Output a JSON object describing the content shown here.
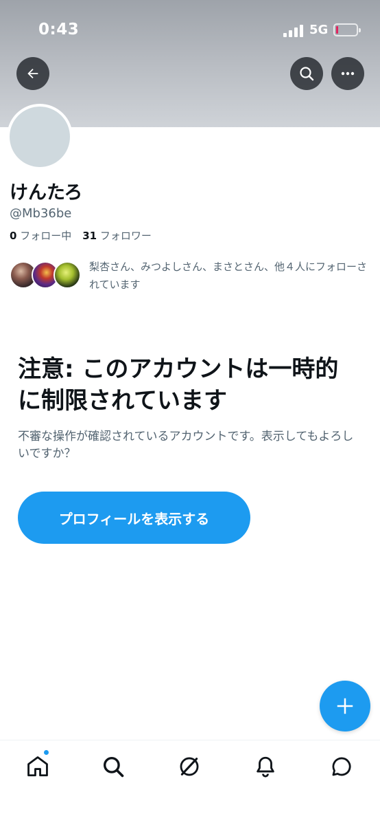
{
  "status_bar": {
    "time": "0:43",
    "network": "5G",
    "battery_level_fraction": 0.08,
    "battery_color": "#e0245e"
  },
  "header": {
    "back_icon": "arrow-left-icon",
    "search_icon": "search-icon",
    "more_icon": "more-horizontal-icon"
  },
  "profile": {
    "display_name": "けんたろ",
    "handle": "@Mb36be",
    "following_count": "0",
    "following_label": "フォロー中",
    "followers_count": "31",
    "followers_label": "フォロワー",
    "followed_by_text": "梨杏さん、みつよしさん、まさとさん、他４人にフォローされています"
  },
  "warning": {
    "title": "注意: このアカウントは一時的に制限されています",
    "body": "不審な操作が確認されているアカウントです。表示してもよろしいですか？",
    "button_label": "プロフィールを表示する"
  },
  "fab": {
    "icon": "plus-icon"
  },
  "tab_bar": {
    "items": [
      {
        "name": "home",
        "icon": "home-icon",
        "has_badge": true
      },
      {
        "name": "search",
        "icon": "search-icon"
      },
      {
        "name": "spaces",
        "icon": "spaces-icon"
      },
      {
        "name": "notifications",
        "icon": "bell-icon"
      },
      {
        "name": "messages",
        "icon": "message-icon"
      }
    ]
  },
  "colors": {
    "accent": "#1d9bf0",
    "text_primary": "#0f1419",
    "text_secondary": "#536471"
  }
}
